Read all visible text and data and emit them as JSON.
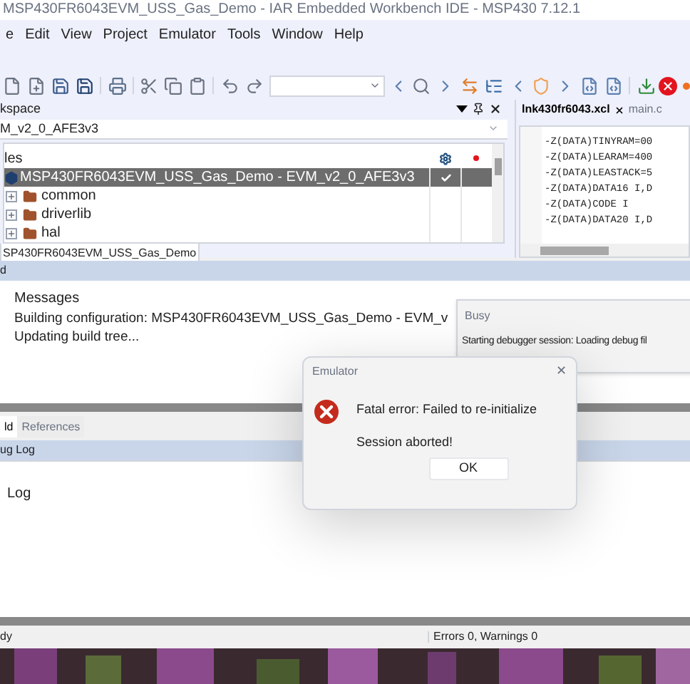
{
  "window": {
    "title": "MSP430FR6043EVM_USS_Gas_Demo - IAR Embedded Workbench IDE - MSP430 7.12.1"
  },
  "menu": [
    "e",
    "Edit",
    "View",
    "Project",
    "Emulator",
    "Tools",
    "Window",
    "Help"
  ],
  "workspace": {
    "title": "kspace",
    "configuration": "M_v2_0_AFE3v3",
    "files_header": "les",
    "tree": [
      {
        "label": "MSP430FR6043EVM_USS_Gas_Demo - EVM_v2_0_AFE3v3",
        "selected": true,
        "checked": true,
        "kind": "project",
        "children": [
          {
            "label": "common",
            "selected": false,
            "kind": "folder",
            "expanded": false
          },
          {
            "label": "driverlib",
            "selected": false,
            "kind": "folder",
            "expanded": false
          },
          {
            "label": "hal",
            "selected": false,
            "kind": "folder",
            "expanded": false
          }
        ]
      }
    ],
    "tab": "SP430FR6043EVM_USS_Gas_Demo"
  },
  "editor": {
    "tabs": [
      {
        "label": "lnk430fr6043.xcl",
        "selected": true
      },
      {
        "label": "main.c",
        "selected": false
      }
    ],
    "lines": [
      "-Z(DATA)TINYRAM=00",
      "-Z(DATA)LEARAM=400",
      "-Z(DATA)LEASTACK=5",
      "-Z(DATA)DATA16 I,D",
      "-Z(DATA)CODE I",
      "-Z(DATA)DATA20 I,D"
    ]
  },
  "build_header": "d",
  "messages": {
    "title": "Messages",
    "lines": [
      "Building configuration: MSP430FR6043EVM_USS_Gas_Demo - EVM_v",
      "Updating build tree..."
    ]
  },
  "bottom_tabs": [
    {
      "label": "ld",
      "selected": true
    },
    {
      "label": "References",
      "selected": false
    }
  ],
  "debug_log": {
    "header": "ug Log",
    "title": "Log"
  },
  "status_bar": {
    "left": "dy",
    "errors": "Errors 0, Warnings 0"
  },
  "busy_dialog": {
    "title": "Busy",
    "text": "Starting debugger session: Loading debug fil"
  },
  "error_dialog": {
    "title": "Emulator",
    "close": "✕",
    "message": "Fatal error: Failed to re-initialize",
    "detail": "Session aborted!",
    "button": "OK"
  }
}
